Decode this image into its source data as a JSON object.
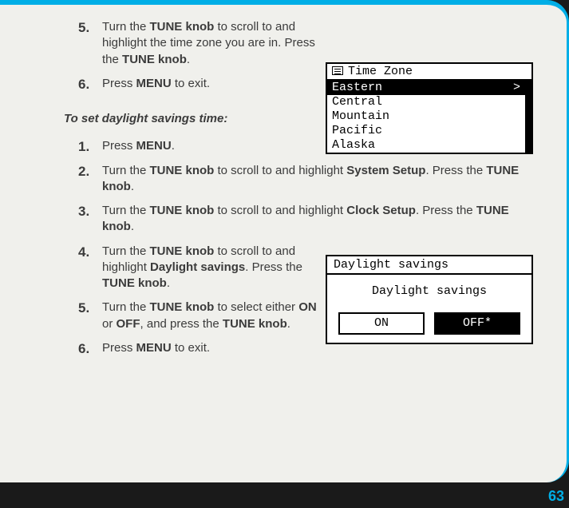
{
  "page_number": "63",
  "section1": {
    "step5": {
      "num": "5.",
      "pre": "Turn the ",
      "b1": "TUNE knob",
      "mid": " to scroll to and highlight the time zone you are in. Press the ",
      "b2": "TUNE knob",
      "post": "."
    },
    "step6": {
      "num": "6.",
      "pre": "Press ",
      "b1": "MENU",
      "post": " to exit."
    }
  },
  "heading": "To set daylight savings time:",
  "section2": {
    "step1": {
      "num": "1.",
      "pre": "Press ",
      "b1": "MENU",
      "post": "."
    },
    "step2": {
      "num": "2.",
      "pre": "Turn the ",
      "b1": "TUNE knob",
      "mid": " to scroll to and highlight ",
      "b2": "System Setup",
      "mid2": ". Press the ",
      "b3": "TUNE knob",
      "post": "."
    },
    "step3": {
      "num": "3.",
      "pre": "Turn the ",
      "b1": "TUNE knob",
      "mid": " to scroll to and highlight ",
      "b2": "Clock Setup",
      "mid2": ". Press the ",
      "b3": "TUNE knob",
      "post": "."
    },
    "step4": {
      "num": "4.",
      "pre": "Turn the ",
      "b1": "TUNE knob",
      "mid": " to scroll to and highlight ",
      "b2": "Daylight savings",
      "mid2": ". Press the ",
      "b3": "TUNE knob",
      "post": "."
    },
    "step5": {
      "num": "5.",
      "pre": "Turn the ",
      "b1": "TUNE knob",
      "mid": " to select either ",
      "b2": "ON",
      "mid2": " or ",
      "b3": "OFF",
      "mid3": ", and press the ",
      "b4": "TUNE knob",
      "post": "."
    },
    "step6": {
      "num": "6.",
      "pre": "Press ",
      "b1": "MENU",
      "post": " to exit."
    }
  },
  "timezone_menu": {
    "title": "Time Zone",
    "items": [
      "Eastern",
      "Central",
      "Mountain",
      "Pacific",
      "Alaska"
    ],
    "selected_index": 0,
    "chevron": ">"
  },
  "daylight_menu": {
    "title": "Daylight savings",
    "label": "Daylight savings",
    "on": "ON",
    "off": "OFF*",
    "selected": "off"
  }
}
